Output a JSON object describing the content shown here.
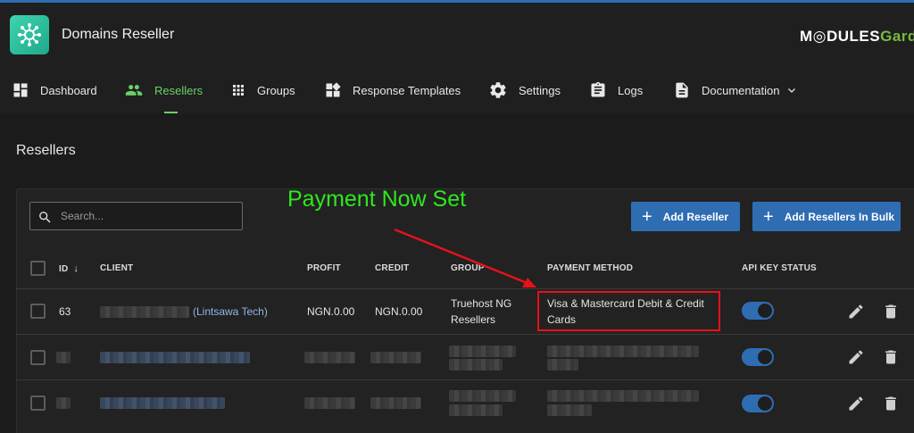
{
  "header": {
    "app_title": "Domains Reseller",
    "brand_left": "M◎DULES",
    "brand_right": "Garde"
  },
  "nav": [
    {
      "label": "Dashboard",
      "icon": "dashboard-icon"
    },
    {
      "label": "Resellers",
      "icon": "people-icon",
      "active": true
    },
    {
      "label": "Groups",
      "icon": "grid-icon"
    },
    {
      "label": "Response Templates",
      "icon": "widgets-icon"
    },
    {
      "label": "Settings",
      "icon": "gear-icon"
    },
    {
      "label": "Logs",
      "icon": "clipboard-icon"
    },
    {
      "label": "Documentation",
      "icon": "document-icon"
    }
  ],
  "page": {
    "title": "Resellers"
  },
  "search": {
    "placeholder": "Search..."
  },
  "toolbar": {
    "add_reseller": "Add Reseller",
    "add_bulk": "Add Resellers In Bulk"
  },
  "annotation": {
    "text": "Payment Now Set"
  },
  "table": {
    "headers": {
      "id": "ID",
      "client": "CLIENT",
      "profit": "PROFIT",
      "credit": "CREDIT",
      "group": "GROUP",
      "payment_method": "PAYMENT METHOD",
      "api_key_status": "API KEY STATUS"
    },
    "rows": [
      {
        "id": "63",
        "client_company": "(Lintsawa Tech)",
        "profit": "NGN.0.00",
        "credit": "NGN.0.00",
        "group_line1": "Truehost NG",
        "group_line2": "Resellers",
        "payment_line1": "Visa & Mastercard Debit & Credit",
        "payment_line2": "Cards",
        "api_key_enabled": true
      }
    ]
  },
  "colors": {
    "accent": "#2f6db3",
    "active_nav": "#6ccf69",
    "annotation": "#2ee81c",
    "highlight_box": "#e8101a"
  }
}
